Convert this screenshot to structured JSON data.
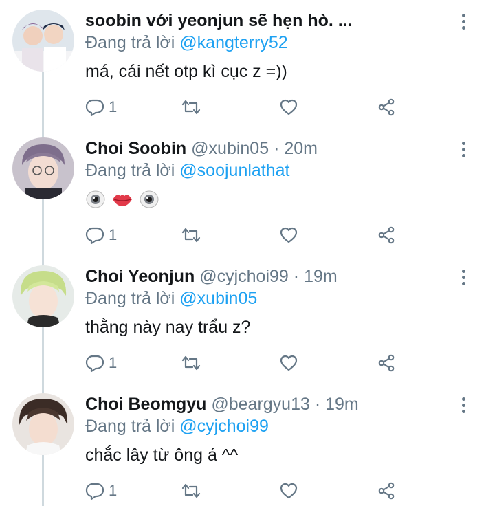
{
  "tweets": [
    {
      "name": "soobin với yeonjun sẽ hẹn hò. ...",
      "handle": "",
      "time": "",
      "reply_prefix": "Đang trả lời",
      "reply_to": "@kangterry52",
      "text": "má, cái nết otp kì cục z =))",
      "reply_count": "1"
    },
    {
      "name": "Choi Soobin",
      "handle": "@xubin05",
      "sep": "·",
      "time": "20m",
      "reply_prefix": "Đang trả lời",
      "reply_to": "@soojunlathat",
      "emojis": [
        "eye",
        "lips",
        "eye"
      ],
      "reply_count": "1"
    },
    {
      "name": "Choi Yeonjun",
      "handle": "@cyjchoi99",
      "sep": "·",
      "time": "19m",
      "reply_prefix": "Đang trả lời",
      "reply_to": "@xubin05",
      "text": "thằng này nay trẩu z?",
      "reply_count": "1"
    },
    {
      "name": "Choi Beomgyu",
      "handle": "@beargyu13",
      "sep": "·",
      "time": "19m",
      "reply_prefix": "Đang trả lời",
      "reply_to": "@cyjchoi99",
      "text": "chắc lây từ ông á ^^",
      "reply_count": "1"
    }
  ],
  "colors": {
    "accent": "#1da1f2",
    "muted": "#657786",
    "text": "#14171a",
    "line": "#cfd9de"
  },
  "icons": [
    "reply-icon",
    "retweet-icon",
    "like-icon",
    "share-icon",
    "more-icon"
  ]
}
